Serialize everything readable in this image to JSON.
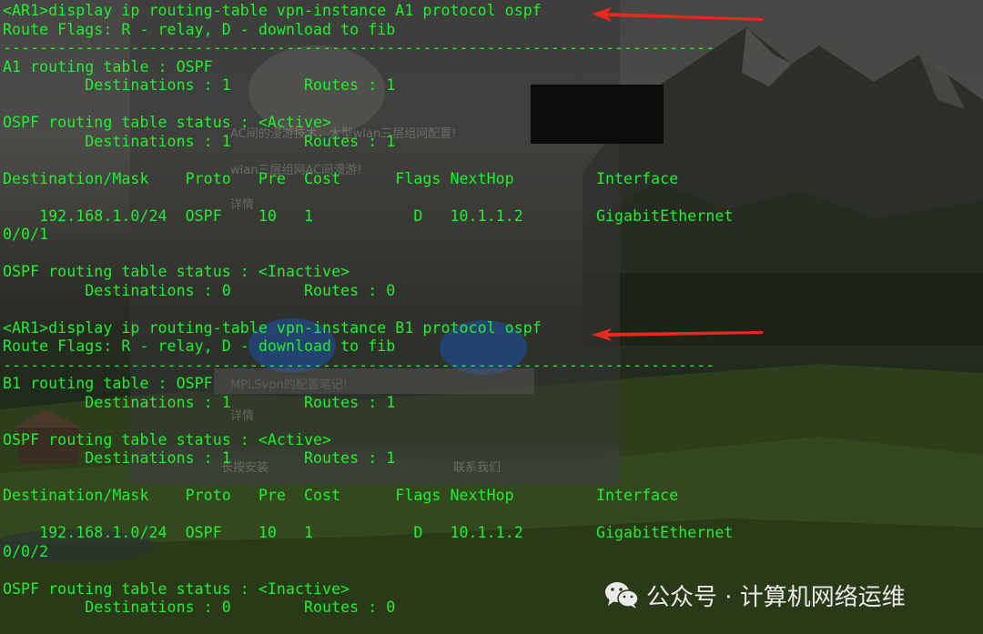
{
  "terminal": {
    "lines": [
      "<AR1>display ip routing-table vpn-instance A1 protocol ospf",
      "Route Flags: R - relay, D - download to fib",
      "------------------------------------------------------------------------------",
      "A1 routing table : OSPF",
      "         Destinations : 1        Routes : 1",
      "",
      "OSPF routing table status : <Active>",
      "         Destinations : 1        Routes : 1",
      "",
      "Destination/Mask    Proto   Pre  Cost      Flags NextHop         Interface",
      "",
      "    192.168.1.0/24  OSPF    10   1           D   10.1.1.2        GigabitEthernet",
      "0/0/1",
      "",
      "OSPF routing table status : <Inactive>",
      "         Destinations : 0        Routes : 0",
      "",
      "<AR1>display ip routing-table vpn-instance B1 protocol ospf",
      "Route Flags: R - relay, D - download to fib",
      "------------------------------------------------------------------------------",
      "B1 routing table : OSPF",
      "         Destinations : 1        Routes : 1",
      "",
      "OSPF routing table status : <Active>",
      "         Destinations : 1        Routes : 1",
      "",
      "Destination/Mask    Proto   Pre  Cost      Flags NextHop         Interface",
      "",
      "    192.168.1.0/24  OSPF    10   1           D   10.1.1.2        GigabitEthernet",
      "0/0/2",
      "",
      "OSPF routing table status : <Inactive>",
      "         Destinations : 0        Routes : 0"
    ]
  },
  "ghost": {
    "title1": "AC间的漫游技术，大型wlan三层组网配置!",
    "title2": "wlan三层组网AC间漫游!",
    "details1": "详情",
    "title3": "MPLSvpn的配置笔记!",
    "details2": "详情",
    "foot_left": "长按安装",
    "foot_right": "联系我们"
  },
  "watermark": {
    "text": "公众号 · 计算机网络运维",
    "icon": "wechat-icon"
  },
  "colors": {
    "terminal_text": "#20ee30",
    "arrow": "#e8281e",
    "watermark": "#e9e9e9"
  }
}
